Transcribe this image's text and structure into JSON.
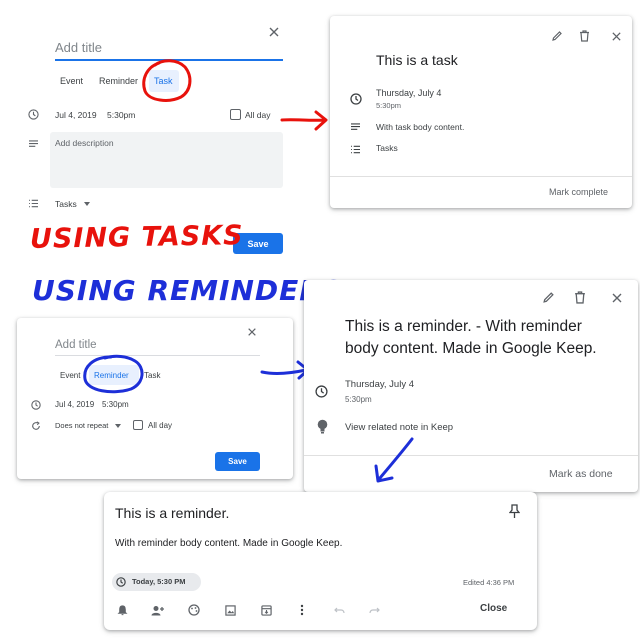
{
  "task_dialog": {
    "title_placeholder": "Add title",
    "tabs": [
      "Event",
      "Reminder",
      "Task"
    ],
    "date": "Jul 4, 2019",
    "time": "5:30pm",
    "all_day": "All day",
    "description_placeholder": "Add description",
    "list_select": "Tasks",
    "save": "Save"
  },
  "task_detail": {
    "title": "This is a task",
    "date": "Thursday, July 4",
    "time": "5:30pm",
    "body": "With task body content.",
    "list": "Tasks",
    "mark_complete": "Mark complete"
  },
  "annotations": {
    "using_tasks": "USING TASKS",
    "using_reminders": "USING REMINDERS",
    "tasks_color": "#e8120c",
    "reminders_color": "#1d2fd8"
  },
  "reminder_dialog": {
    "title_placeholder": "Add title",
    "tabs": [
      "Event",
      "Reminder",
      "Task"
    ],
    "date": "Jul 4, 2019",
    "time": "5:30pm",
    "repeat": "Does not repeat",
    "all_day": "All day",
    "save": "Save"
  },
  "reminder_detail": {
    "title_line1": "This is a reminder. - With reminder",
    "title_line2": "body content. Made in Google Keep.",
    "date": "Thursday, July 4",
    "time": "5:30pm",
    "keep_link": "View related note in Keep",
    "mark_done": "Mark as done"
  },
  "keep_note": {
    "title": "This is a reminder.",
    "body": "With reminder body content. Made in Google Keep.",
    "reminder_chip": "Today, 5:30 PM",
    "edited": "Edited 4:36 PM",
    "close": "Close",
    "toolbar_icons": [
      "add-reminder-icon",
      "collaborator-icon",
      "palette-icon",
      "image-icon",
      "archive-icon",
      "more-icon",
      "undo-icon",
      "redo-icon"
    ]
  },
  "colors": {
    "accent": "#1a73e8",
    "tab_active_bg": "#e8f0fe"
  }
}
